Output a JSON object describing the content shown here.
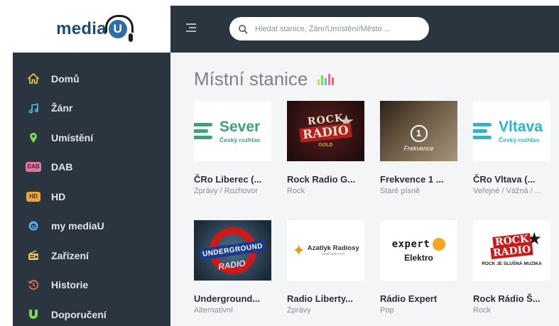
{
  "brand": {
    "name": "media",
    "u": "U"
  },
  "search": {
    "placeholder": "Hledat stanice, Žánr/Umístění/Město ..."
  },
  "nav": [
    {
      "label": "Domů",
      "icon": "home-icon",
      "color": "#f2c94c"
    },
    {
      "label": "Žánr",
      "icon": "music-note-icon",
      "color": "#4fc3f7"
    },
    {
      "label": "Umístění",
      "icon": "location-pin-icon",
      "color": "#7ed957"
    },
    {
      "label": "DAB",
      "icon": "dab-badge-icon",
      "color": "#ec6fa0",
      "badge": "DAB"
    },
    {
      "label": "HD",
      "icon": "hd-badge-icon",
      "color": "#f2a23a",
      "badge": "HD"
    },
    {
      "label": "my mediaU",
      "icon": "mediau-icon",
      "color": "#5ab0f0"
    },
    {
      "label": "Zařízení",
      "icon": "radio-device-icon",
      "color": "#f2c94c"
    },
    {
      "label": "Historie",
      "icon": "history-icon",
      "color": "#f26a4b"
    },
    {
      "label": "Doporučení",
      "icon": "recommend-icon",
      "color": "#7ed957"
    }
  ],
  "main": {
    "title": "Místní stanice"
  },
  "stations": [
    {
      "name": "ČRo Liberec (...",
      "genre": "Zprávy / Rozhovor",
      "logo_main": "Sever",
      "logo_sub": "Český rozhlas",
      "color": "#3aa37a"
    },
    {
      "name": "Rock Radio G...",
      "genre": "Rock",
      "logo_main": "ROCK",
      "logo_second": "RADIO",
      "logo_sub": "GOLD"
    },
    {
      "name": "Frekvence 1 ...",
      "genre": "Staré písně",
      "logo_main": "1",
      "logo_sub": "Frekvence"
    },
    {
      "name": "ČRo Vltava (...",
      "genre": "Veřejné / Vážná / ...",
      "logo_main": "Vltava",
      "logo_sub": "Český rozhlas",
      "color": "#2bb6c9"
    },
    {
      "name": "Underground...",
      "genre": "Alternativní",
      "logo_main": "UNDERGROUND",
      "logo_sub": "RADIO"
    },
    {
      "name": "Radio Liberty...",
      "genre": "Zprávy",
      "logo_main": "Azatlyk Radiosy",
      "logo_sub": "azathabar.com"
    },
    {
      "name": "Rádio Expert",
      "genre": "Pop",
      "logo_main": "expert",
      "logo_sub": "Elektro"
    },
    {
      "name": "Rock Rádio Š...",
      "genre": "Rock",
      "logo_main": "ROCK",
      "logo_second": "RADIO",
      "logo_sub": "ROCK JE SLUŠNÁ MUZIKA"
    }
  ]
}
